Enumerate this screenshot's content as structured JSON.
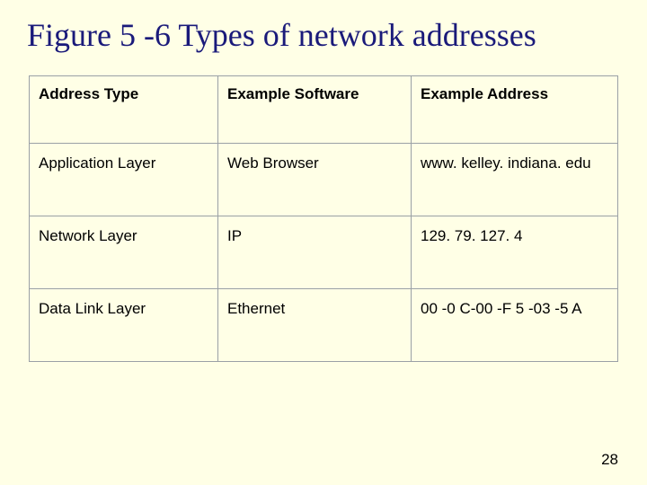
{
  "title": "Figure 5 -6 Types of network addresses",
  "table": {
    "headers": [
      "Address Type",
      "Example Software",
      "Example Address"
    ],
    "rows": [
      [
        "Application Layer",
        "Web Browser",
        "www. kelley. indiana. edu"
      ],
      [
        "Network Layer",
        "IP",
        "129. 79. 127. 4"
      ],
      [
        "Data Link Layer",
        "Ethernet",
        "00 -0 C-00 -F 5 -03 -5 A"
      ]
    ]
  },
  "page_number": "28"
}
